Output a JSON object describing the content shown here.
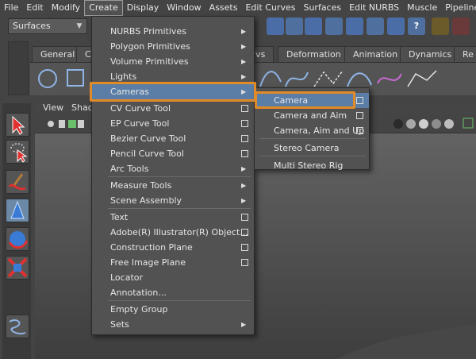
{
  "menubar": [
    "File",
    "Edit",
    "Modify",
    "Create",
    "Display",
    "Window",
    "Assets",
    "Edit Curves",
    "Surfaces",
    "Edit NURBS",
    "Muscle",
    "Pipeline C"
  ],
  "active_menu": "Create",
  "mode_select": {
    "value": "Surfaces"
  },
  "shelf_tabs": [
    "General",
    "C",
    "ivs",
    "Deformation",
    "Animation",
    "Dynamics",
    "Re"
  ],
  "panel_menu": [
    "View",
    "Shad"
  ],
  "create_menu": [
    {
      "label": "NURBS Primitives",
      "submenu": true
    },
    {
      "label": "Polygon Primitives",
      "submenu": true
    },
    {
      "label": "Volume Primitives",
      "submenu": true
    },
    {
      "label": "Lights",
      "submenu": true
    },
    {
      "label": "Cameras",
      "submenu": true,
      "highlighted": true
    },
    {
      "label": "CV Curve Tool",
      "option": true
    },
    {
      "label": "EP Curve Tool",
      "option": true
    },
    {
      "label": "Bezier Curve Tool",
      "option": true
    },
    {
      "label": "Pencil Curve Tool",
      "option": true
    },
    {
      "label": "Arc Tools",
      "submenu": true
    },
    {
      "label": "Measure Tools",
      "submenu": true
    },
    {
      "label": "Scene Assembly",
      "submenu": true
    },
    {
      "label": "Text",
      "option": true
    },
    {
      "label": "Adobe(R) Illustrator(R) Object...",
      "option": true
    },
    {
      "label": "Construction Plane",
      "option": true
    },
    {
      "label": "Free Image Plane",
      "option": true
    },
    {
      "label": "Locator"
    },
    {
      "label": "Annotation..."
    },
    {
      "label": "Empty Group"
    },
    {
      "label": "Sets",
      "submenu": true
    }
  ],
  "cameras_menu": [
    {
      "label": "Camera",
      "option": true,
      "highlighted": true
    },
    {
      "label": "Camera and Aim",
      "option": true
    },
    {
      "label": "Camera, Aim and Up",
      "option": true
    },
    {
      "label": "Stereo Camera"
    },
    {
      "label": "Multi Stereo Rig"
    }
  ],
  "colors": {
    "highlight": "#5b7ea6",
    "callout": "#e08a28",
    "menu_bg": "#525252"
  },
  "icons": {
    "submenu": "triangle-right",
    "option_box": "square-outline"
  }
}
